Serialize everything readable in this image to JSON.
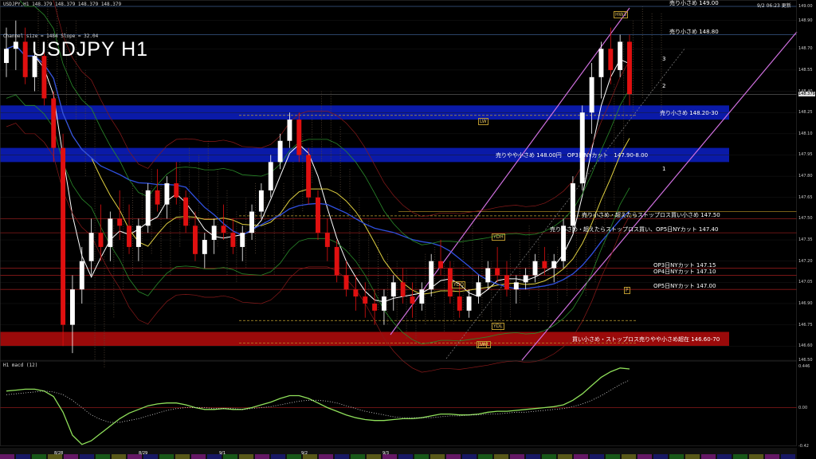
{
  "header": {
    "symbol_title": "USDJPY H1",
    "info_line": "USDJPY,H1  148.379 148.379 148.379 148.379",
    "channel_info": "Channel size = 1484  Slope = 32.04",
    "clock": "9/2 06:23 更新",
    "macd_title": "H1  macd (12)"
  },
  "colors": {
    "background": "#000000",
    "zone_blue": "#0a1aa8",
    "zone_red": "#9a0a0a",
    "bull_candle": "#ffffff",
    "bear_candle": "#e01010",
    "channel": "#d070e0",
    "macd": "#8fe05a",
    "signal": "#e06070"
  },
  "chart_data": {
    "type": "candlestick",
    "symbol": "USDJPY",
    "timeframe": "H1",
    "ylim": [
      146.5,
      149.0
    ],
    "macd_ylim": [
      -0.42,
      0.446
    ],
    "y_ticks": [
      "149.00",
      "148.90",
      "148.70",
      "148.55",
      "148.40",
      "148.25",
      "148.10",
      "147.95",
      "147.80",
      "147.65",
      "147.50",
      "147.35",
      "147.20",
      "147.05",
      "146.90",
      "146.75",
      "146.60",
      "146.50"
    ],
    "macd_ticks": [
      "0.446",
      "0.00",
      "-0.42"
    ],
    "date_labels": [
      "8/28",
      "8/29",
      "9/1",
      "9/2",
      "9/3"
    ],
    "current_price": "148.379",
    "levels": [
      {
        "price": 149.0,
        "text": "売り小さめ 149.00"
      },
      {
        "price": 148.8,
        "text": "売り小さめ 148.80"
      },
      {
        "price": 147.5,
        "text": "売り小さめ・超えたらストップロス買い小さめ 147.50"
      },
      {
        "price": 147.4,
        "text": "売り小さめ・超えたらストップロス買い、OP5日NYカット 147.40"
      },
      {
        "price": 147.15,
        "text": "OP3日NYカット 147.15"
      },
      {
        "price": 147.1,
        "text": "OP4日NYカット 147.10"
      },
      {
        "price": 147.0,
        "text": "OP5日NYカット 147.00"
      }
    ],
    "zones": [
      {
        "color": "blue",
        "from": 148.2,
        "to": 148.3,
        "text": "売り小さめ 148.20-30"
      },
      {
        "color": "blue",
        "from": 147.9,
        "to": 148.0,
        "text": "売りやや小さめ 148.00円　OP3日NYカット　147.90-8.00"
      },
      {
        "color": "red",
        "from": 146.6,
        "to": 146.7,
        "text": "買い小さめ・ストップロス売りやや小さめ超在 146.60-70"
      }
    ],
    "marker_labels": [
      "LW",
      "LW",
      "YDH",
      "YDO",
      "YDL",
      "LWL",
      "P",
      "1",
      "2",
      "3",
      "HW3"
    ],
    "ohlc": [
      [
        148.6,
        148.85,
        148.5,
        148.7
      ],
      [
        148.7,
        148.9,
        148.55,
        148.75
      ],
      [
        148.75,
        148.85,
        148.45,
        148.5
      ],
      [
        148.5,
        148.7,
        148.4,
        148.65
      ],
      [
        148.65,
        148.75,
        148.3,
        148.35
      ],
      [
        148.35,
        148.4,
        147.9,
        148.0
      ],
      [
        148.0,
        148.1,
        146.6,
        146.75
      ],
      [
        146.75,
        147.1,
        146.55,
        147.0
      ],
      [
        147.0,
        147.3,
        146.9,
        147.2
      ],
      [
        147.2,
        147.5,
        147.1,
        147.4
      ],
      [
        147.4,
        147.6,
        147.2,
        147.3
      ],
      [
        147.3,
        147.55,
        147.2,
        147.5
      ],
      [
        147.5,
        147.7,
        147.35,
        147.45
      ],
      [
        147.45,
        147.6,
        147.25,
        147.3
      ],
      [
        147.3,
        147.5,
        147.2,
        147.45
      ],
      [
        147.45,
        147.75,
        147.4,
        147.7
      ],
      [
        147.7,
        147.85,
        147.55,
        147.6
      ],
      [
        147.6,
        147.8,
        147.5,
        147.75
      ],
      [
        147.75,
        147.9,
        147.6,
        147.65
      ],
      [
        147.65,
        147.7,
        147.4,
        147.45
      ],
      [
        147.45,
        147.55,
        147.2,
        147.25
      ],
      [
        147.25,
        147.4,
        147.15,
        147.35
      ],
      [
        147.35,
        147.5,
        147.25,
        147.45
      ],
      [
        147.45,
        147.6,
        147.35,
        147.4
      ],
      [
        147.4,
        147.5,
        147.25,
        147.3
      ],
      [
        147.3,
        147.45,
        147.2,
        147.4
      ],
      [
        147.4,
        147.6,
        147.35,
        147.55
      ],
      [
        147.55,
        147.75,
        147.5,
        147.7
      ],
      [
        147.7,
        147.95,
        147.65,
        147.9
      ],
      [
        147.9,
        148.1,
        147.85,
        148.05
      ],
      [
        148.05,
        148.25,
        148.0,
        148.2
      ],
      [
        148.2,
        148.25,
        147.9,
        147.95
      ],
      [
        147.95,
        148.0,
        147.6,
        147.65
      ],
      [
        147.65,
        147.7,
        147.35,
        147.4
      ],
      [
        147.4,
        147.5,
        147.2,
        147.3
      ],
      [
        147.3,
        147.35,
        147.05,
        147.1
      ],
      [
        147.1,
        147.2,
        146.95,
        147.0
      ],
      [
        147.0,
        147.1,
        146.85,
        146.95
      ],
      [
        146.95,
        147.05,
        146.8,
        146.9
      ],
      [
        146.9,
        147.0,
        146.75,
        146.85
      ],
      [
        146.85,
        147.0,
        146.75,
        146.95
      ],
      [
        146.95,
        147.1,
        146.85,
        147.05
      ],
      [
        147.05,
        147.15,
        146.9,
        146.95
      ],
      [
        146.95,
        147.05,
        146.8,
        146.9
      ],
      [
        146.9,
        147.05,
        146.85,
        147.0
      ],
      [
        147.0,
        147.25,
        146.95,
        147.2
      ],
      [
        147.2,
        147.35,
        147.1,
        147.15
      ],
      [
        147.15,
        147.2,
        146.9,
        146.95
      ],
      [
        146.95,
        147.05,
        146.8,
        146.85
      ],
      [
        146.85,
        147.0,
        146.8,
        146.95
      ],
      [
        146.95,
        147.1,
        146.9,
        147.05
      ],
      [
        147.05,
        147.2,
        147.0,
        147.15
      ],
      [
        147.15,
        147.3,
        147.05,
        147.1
      ],
      [
        147.1,
        147.2,
        146.95,
        147.0
      ],
      [
        147.0,
        147.1,
        146.9,
        147.05
      ],
      [
        147.05,
        147.15,
        147.0,
        147.1
      ],
      [
        147.1,
        147.25,
        147.05,
        147.2
      ],
      [
        147.2,
        147.3,
        147.1,
        147.15
      ],
      [
        147.15,
        147.25,
        147.05,
        147.2
      ],
      [
        147.2,
        147.5,
        147.15,
        147.45
      ],
      [
        147.45,
        147.8,
        147.4,
        147.75
      ],
      [
        147.75,
        148.3,
        147.7,
        148.25
      ],
      [
        148.25,
        148.6,
        148.1,
        148.5
      ],
      [
        148.5,
        148.75,
        148.35,
        148.7
      ],
      [
        148.7,
        148.85,
        148.45,
        148.55
      ],
      [
        148.55,
        148.8,
        148.5,
        148.75
      ],
      [
        148.75,
        148.8,
        148.3,
        148.38
      ]
    ],
    "macd": [
      0.18,
      0.19,
      0.2,
      0.2,
      0.18,
      0.12,
      -0.05,
      -0.3,
      -0.4,
      -0.36,
      -0.28,
      -0.2,
      -0.12,
      -0.06,
      -0.02,
      0.02,
      0.04,
      0.05,
      0.05,
      0.03,
      0.0,
      -0.02,
      -0.02,
      -0.01,
      -0.02,
      -0.02,
      0.0,
      0.03,
      0.06,
      0.1,
      0.13,
      0.13,
      0.1,
      0.05,
      0.0,
      -0.04,
      -0.08,
      -0.11,
      -0.13,
      -0.14,
      -0.14,
      -0.13,
      -0.12,
      -0.12,
      -0.11,
      -0.09,
      -0.07,
      -0.07,
      -0.08,
      -0.08,
      -0.07,
      -0.05,
      -0.04,
      -0.04,
      -0.03,
      -0.02,
      -0.01,
      0.0,
      0.01,
      0.03,
      0.08,
      0.15,
      0.24,
      0.33,
      0.39,
      0.43,
      0.42
    ],
    "signal": [
      0.14,
      0.15,
      0.16,
      0.17,
      0.18,
      0.17,
      0.14,
      0.08,
      0.0,
      -0.08,
      -0.13,
      -0.16,
      -0.16,
      -0.14,
      -0.12,
      -0.09,
      -0.06,
      -0.03,
      -0.01,
      0.0,
      0.0,
      0.0,
      -0.01,
      -0.01,
      -0.01,
      -0.02,
      -0.01,
      0.0,
      0.01,
      0.03,
      0.05,
      0.07,
      0.08,
      0.08,
      0.07,
      0.05,
      0.02,
      -0.01,
      -0.04,
      -0.06,
      -0.08,
      -0.1,
      -0.11,
      -0.11,
      -0.11,
      -0.11,
      -0.1,
      -0.09,
      -0.09,
      -0.08,
      -0.08,
      -0.07,
      -0.07,
      -0.06,
      -0.05,
      -0.05,
      -0.04,
      -0.03,
      -0.02,
      -0.01,
      0.01,
      0.04,
      0.08,
      0.13,
      0.19,
      0.25,
      0.3
    ]
  }
}
